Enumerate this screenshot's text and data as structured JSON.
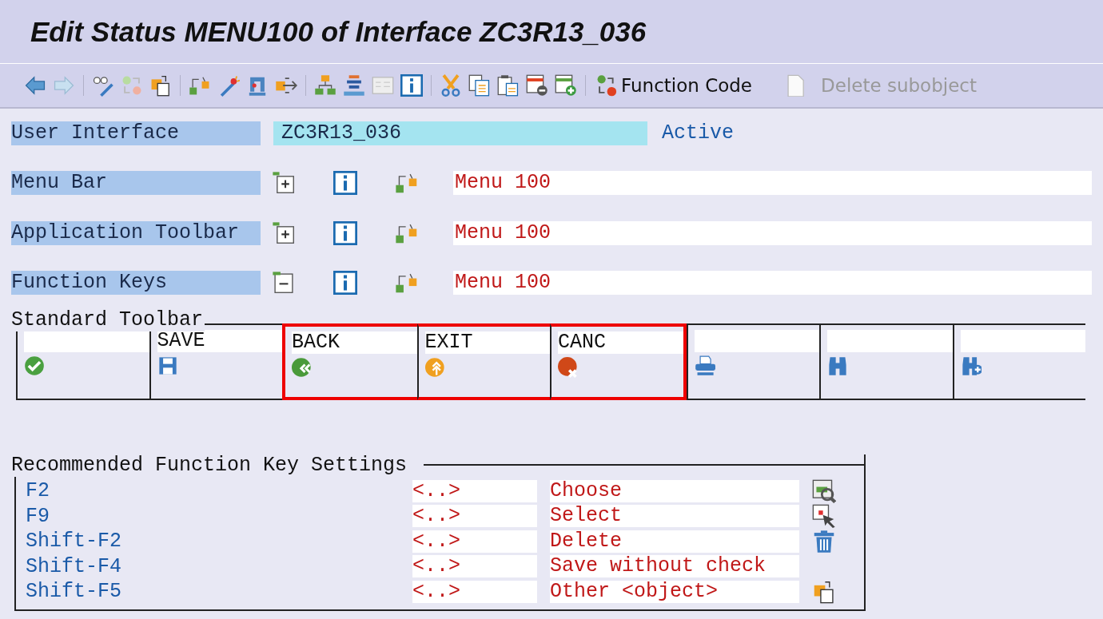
{
  "window": {
    "title": "Edit Status MENU100 of Interface ZC3R13_036"
  },
  "toolbar": [
    {
      "label": "Function Code",
      "disabled": false
    },
    {
      "label": "Delete subobject",
      "disabled": true
    }
  ],
  "user_interface": {
    "label": "User Interface",
    "value": "ZC3R13_036",
    "status": "Active"
  },
  "sections": [
    {
      "label": "Menu Bar",
      "expanded": false,
      "value": "Menu 100"
    },
    {
      "label": "Application Toolbar",
      "expanded": false,
      "value": "Menu 100"
    },
    {
      "label": "Function Keys",
      "expanded": true,
      "value": "Menu 100"
    }
  ],
  "standard_toolbar": {
    "title": "Standard Toolbar",
    "cells": [
      {
        "highlighted": false
      },
      {
        "label": "SAVE",
        "highlighted": false
      },
      {
        "label": "BACK",
        "highlighted": true
      },
      {
        "label": "EXIT",
        "highlighted": true
      },
      {
        "label": "CANC",
        "highlighted": true
      },
      {
        "highlighted": false
      },
      {
        "highlighted": false
      },
      {
        "highlighted": false
      }
    ]
  },
  "recommended": {
    "title": "Recommended Function Key Settings",
    "rows": [
      {
        "key": "F2",
        "code": "<..>",
        "text": "Choose"
      },
      {
        "key": "F9",
        "code": "<..>",
        "text": "Select"
      },
      {
        "key": "Shift-F2",
        "code": "<..>",
        "text": "Delete"
      },
      {
        "key": "Shift-F4",
        "code": "<..>",
        "text": "Save without check"
      },
      {
        "key": "Shift-F5",
        "code": "<..>",
        "text": "Other <object>"
      }
    ]
  }
}
